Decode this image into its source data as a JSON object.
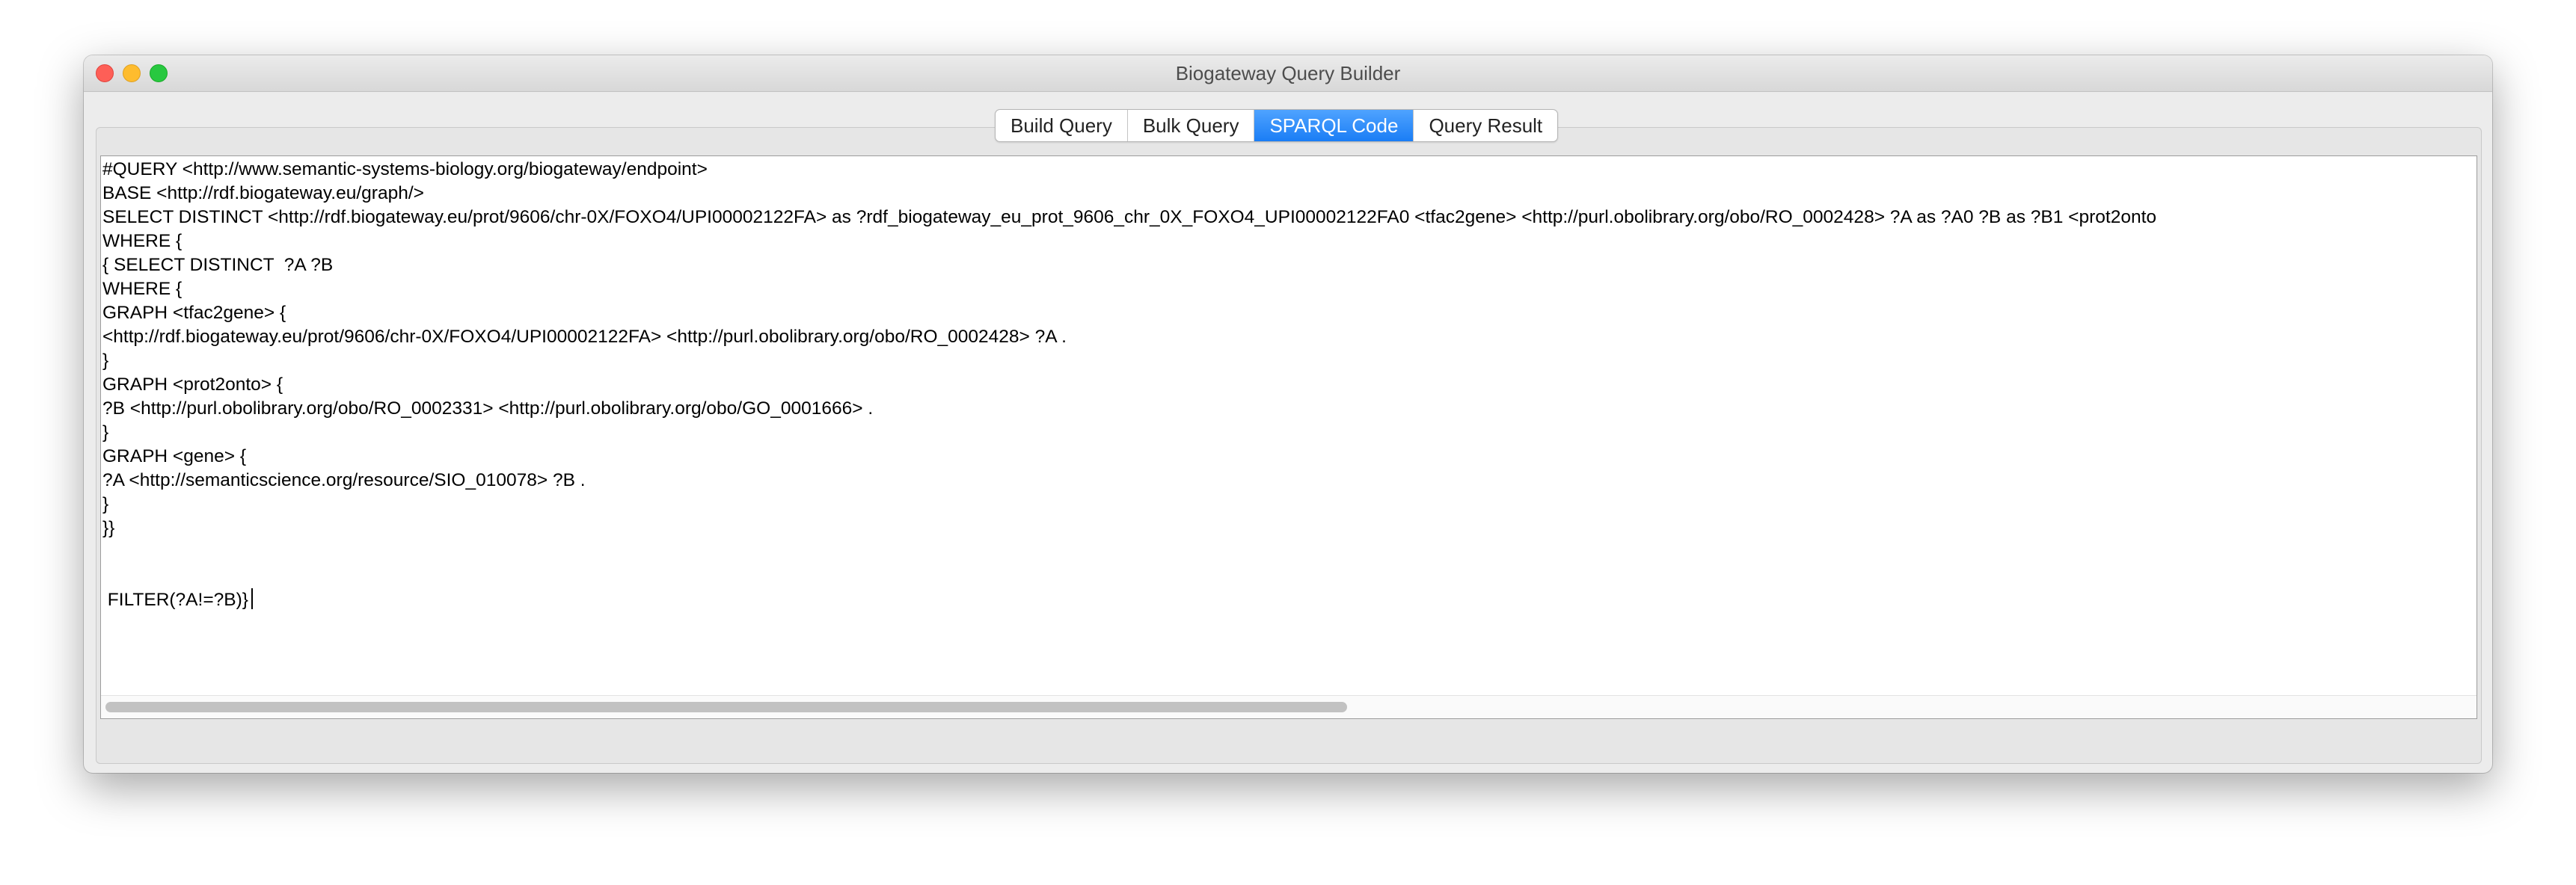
{
  "window": {
    "title": "Biogateway Query Builder"
  },
  "tabs": [
    {
      "label": "Build Query",
      "active": false
    },
    {
      "label": "Bulk Query",
      "active": false
    },
    {
      "label": "SPARQL Code",
      "active": true
    },
    {
      "label": "Query Result",
      "active": false
    }
  ],
  "editor": {
    "lines": [
      "#QUERY <http://www.semantic-systems-biology.org/biogateway/endpoint>",
      "BASE <http://rdf.biogateway.eu/graph/>",
      "SELECT DISTINCT <http://rdf.biogateway.eu/prot/9606/chr-0X/FOXO4/UPI00002122FA> as ?rdf_biogateway_eu_prot_9606_chr_0X_FOXO4_UPI00002122FA0 <tfac2gene> <http://purl.obolibrary.org/obo/RO_0002428> ?A as ?A0 ?B as ?B1 <prot2onto",
      "WHERE {",
      "{ SELECT DISTINCT  ?A ?B",
      "WHERE {",
      "GRAPH <tfac2gene> {",
      "<http://rdf.biogateway.eu/prot/9606/chr-0X/FOXO4/UPI00002122FA> <http://purl.obolibrary.org/obo/RO_0002428> ?A .",
      "}",
      "GRAPH <prot2onto> {",
      "?B <http://purl.obolibrary.org/obo/RO_0002331> <http://purl.obolibrary.org/obo/GO_0001666> .",
      "}",
      "GRAPH <gene> {",
      "?A <http://semanticscience.org/resource/SIO_010078> ?B .",
      "}",
      "}}",
      "",
      "",
      " FILTER(?A!=?B)}"
    ]
  },
  "colors": {
    "active_tab": "#1a7df5",
    "close_button": "#fe5f57",
    "minimize_button": "#febc2e",
    "zoom_button": "#28c840"
  },
  "icons": {
    "close": "close-icon",
    "minimize": "minimize-icon",
    "zoom": "zoom-icon"
  }
}
